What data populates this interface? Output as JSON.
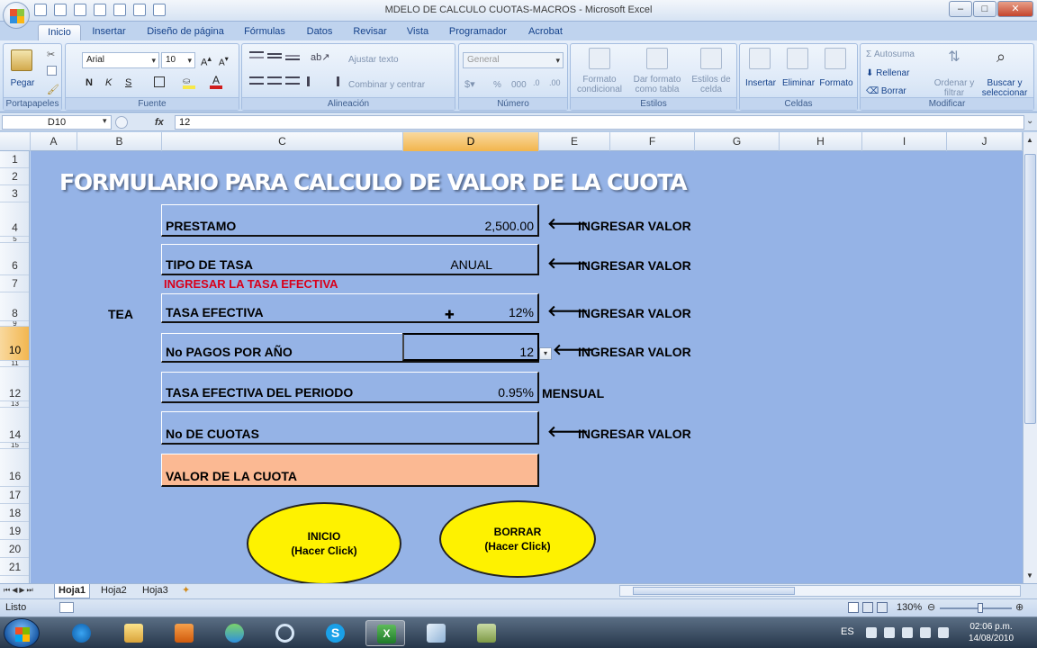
{
  "window": {
    "title": "MDELO DE CALCULO CUOTAS-MACROS - Microsoft Excel",
    "controls": {
      "minimize": "–",
      "maximize": "□",
      "close": "✕"
    }
  },
  "ribbon_tabs": [
    "Inicio",
    "Insertar",
    "Diseño de página",
    "Fórmulas",
    "Datos",
    "Revisar",
    "Vista",
    "Programador",
    "Acrobat"
  ],
  "ribbon": {
    "portapapeles": {
      "label": "Portapapeles",
      "paste": "Pegar"
    },
    "fuente": {
      "label": "Fuente",
      "font": "Arial",
      "size": "10",
      "bold": "N",
      "italic": "K",
      "underline": "S"
    },
    "alineacion": {
      "label": "Alineación",
      "wrap": "Ajustar texto",
      "merge": "Combinar y centrar"
    },
    "numero": {
      "label": "Número",
      "format": "General",
      "percent": "%",
      "thousands": "000"
    },
    "estilos": {
      "label": "Estilos",
      "conditional": "Formato condicional",
      "table": "Dar formato como tabla",
      "cell_styles": "Estilos de celda"
    },
    "celdas": {
      "label": "Celdas",
      "insert": "Insertar",
      "delete": "Eliminar",
      "format": "Formato"
    },
    "modificar": {
      "label": "Modificar",
      "autosum": "Autosuma",
      "fill": "Rellenar",
      "clear": "Borrar",
      "sort": "Ordenar y filtrar",
      "find": "Buscar y seleccionar"
    }
  },
  "formula_bar": {
    "name_box": "D10",
    "fx": "fx",
    "value": "12"
  },
  "columns": [
    "A",
    "B",
    "C",
    "D",
    "E",
    "F",
    "G",
    "H",
    "I",
    "J"
  ],
  "rows": [
    "1",
    "2",
    "3",
    "4",
    "5",
    "6",
    "7",
    "8",
    "9",
    "10",
    "11",
    "12",
    "13",
    "14",
    "15",
    "16",
    "17",
    "18",
    "19",
    "20",
    "21"
  ],
  "sheet": {
    "title": "FORMULARIO PARA CALCULO DE VALOR DE LA CUOTA",
    "fields": [
      {
        "label": "PRESTAMO",
        "value": "2,500.00",
        "hint": "INGRESAR VALOR"
      },
      {
        "label": "TIPO DE TASA",
        "value": "ANUAL",
        "hint": "INGRESAR VALOR"
      },
      {
        "label": "TASA EFECTIVA",
        "value": "12%",
        "hint": "INGRESAR VALOR"
      },
      {
        "label": "No PAGOS POR AÑO",
        "value": "12",
        "hint": "INGRESAR VALOR"
      },
      {
        "label": "TASA EFECTIVA DEL PERIODO",
        "value": "0.95%",
        "hint": ""
      },
      {
        "label": "No DE CUOTAS",
        "value": "",
        "hint": "INGRESAR VALOR"
      },
      {
        "label": "VALOR DE LA CUOTA",
        "value": "",
        "hint": ""
      }
    ],
    "red_message": "INGRESAR LA TASA EFECTIVA",
    "side_label": "TEA",
    "period_unit": "MENSUAL",
    "arrow_glyph": "🡐",
    "buttons": {
      "inicio": {
        "line1": "INICIO",
        "line2": "(Hacer Click)"
      },
      "borrar": {
        "line1": "BORRAR",
        "line2": "(Hacer Click)"
      }
    },
    "colors": {
      "sheet_bg": "#95b3e6",
      "result_bg": "#fbb993",
      "button_fill": "#fef200",
      "warning": "#d9001a"
    }
  },
  "sheet_tabs": [
    "Hoja1",
    "Hoja2",
    "Hoja3"
  ],
  "status": {
    "text": "Listo",
    "zoom": "130%"
  },
  "taskbar": {
    "language": "ES",
    "time": "02:06 p.m.",
    "date": "14/08/2010"
  }
}
